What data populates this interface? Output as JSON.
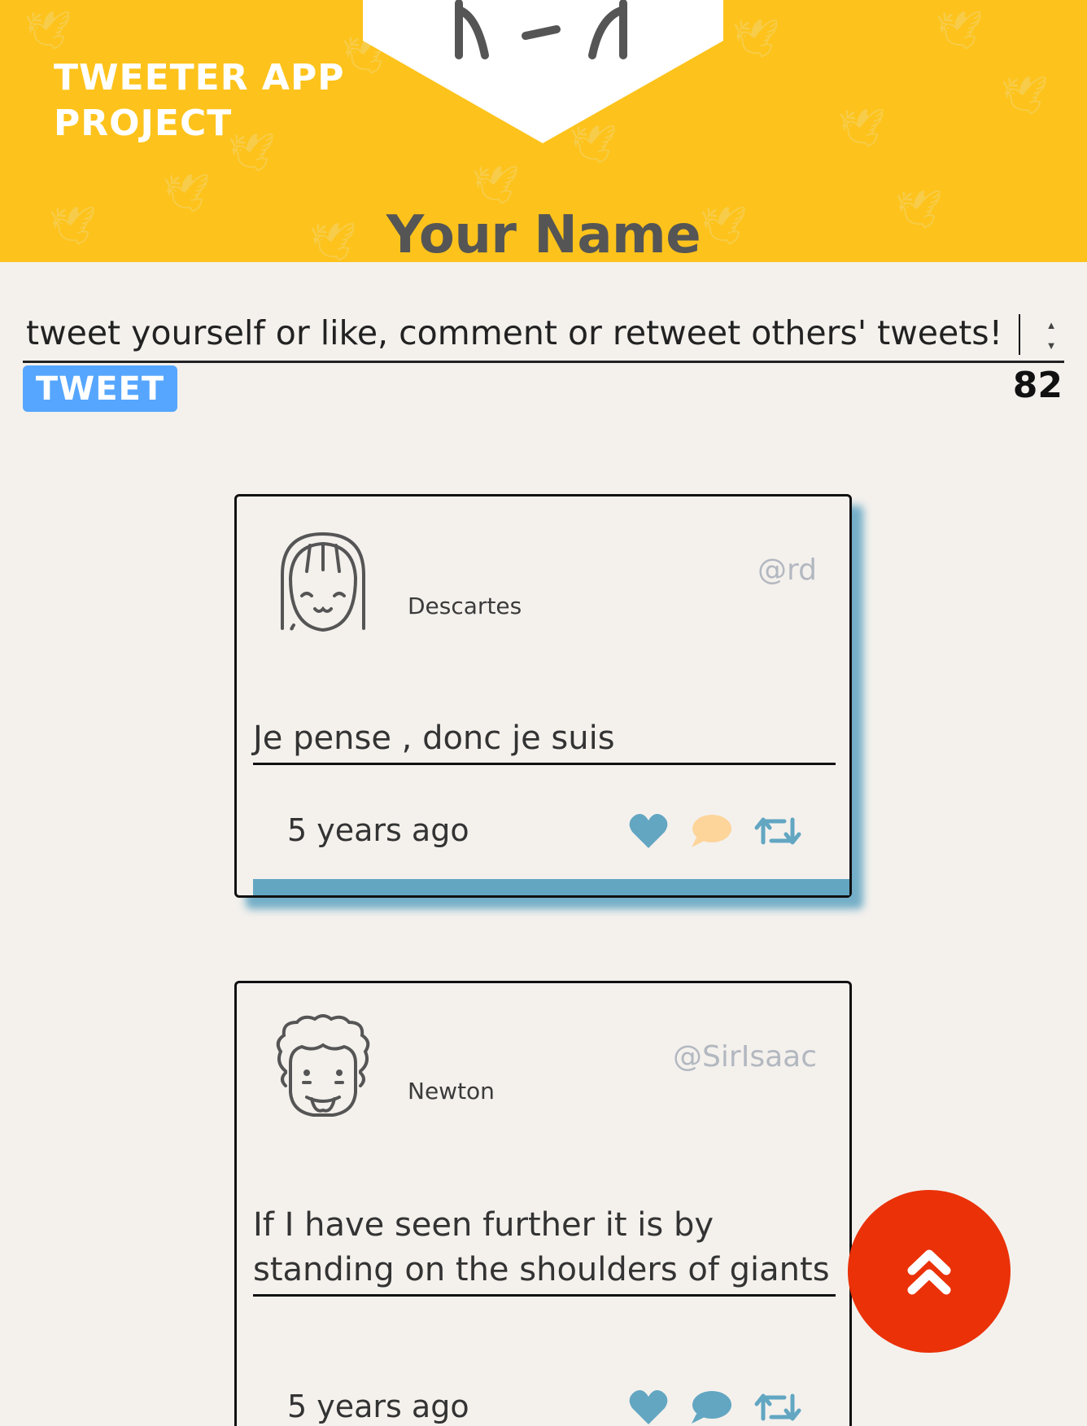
{
  "header": {
    "brand": "TWEETER APP PROJECT",
    "profile_name": "Your Name",
    "background_color": "#fdc31c"
  },
  "compose": {
    "value": "tweet yourself or like, comment or retweet others' tweets!",
    "button_label": "TWEET",
    "char_count": "82",
    "button_color": "#56a6ff"
  },
  "tweets": [
    {
      "author": "Descartes",
      "handle": "@rd",
      "content": "Je pense , donc je suis",
      "timestamp": "5 years ago",
      "icons": [
        "heart-icon",
        "comment-icon",
        "retweet-icon"
      ]
    },
    {
      "author": "Newton",
      "handle": "@SirIsaac",
      "content": "If I have seen further it is by standing on the shoulders of giants",
      "timestamp": "5 years ago",
      "icons": [
        "heart-icon",
        "comment-icon",
        "retweet-icon"
      ]
    }
  ],
  "colors": {
    "accent_blue": "#62a6c2",
    "comment_inactive": "#fdd49a",
    "scroll_button": "#ea3108"
  },
  "scroll_top_icon": "double-chevron-up-icon"
}
